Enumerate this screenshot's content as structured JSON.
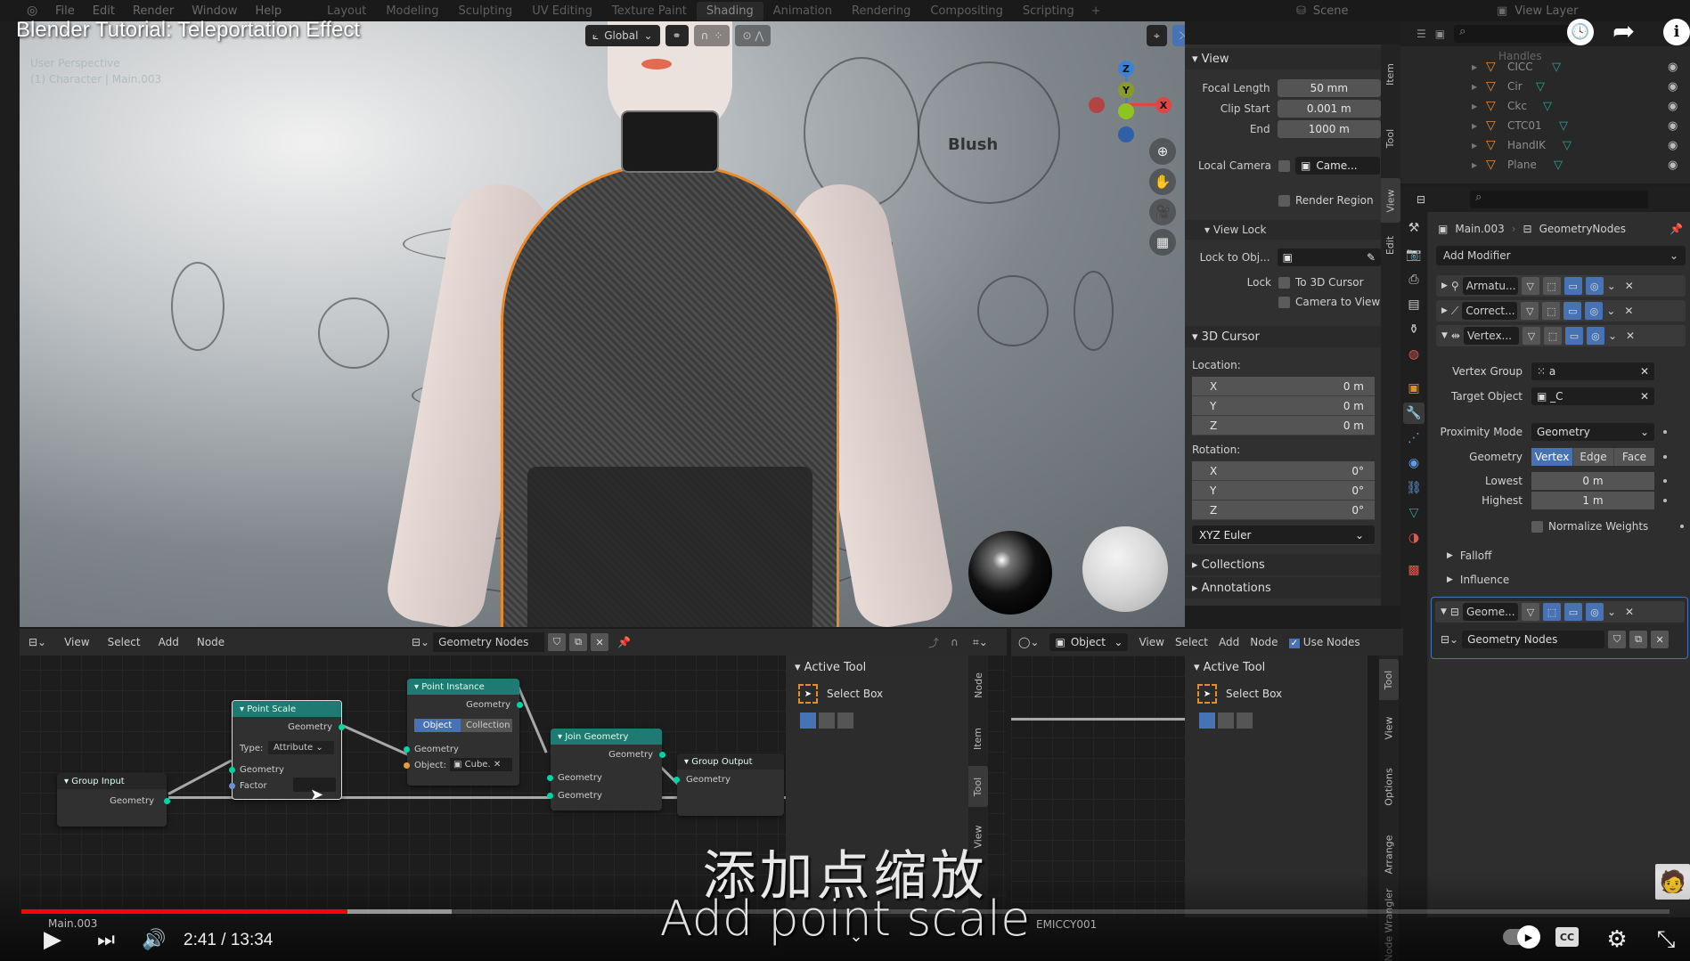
{
  "video": {
    "title": "Blender Tutorial: Teleportation Effect",
    "current_time": "2:41",
    "separator": " / ",
    "duration": "13:34",
    "progress_fraction": 0.198,
    "buffered_fraction": 0.261,
    "subtitle_cn": "添加点缩放",
    "subtitle_en": "Add point scale",
    "watermark": "EMICCY001",
    "chapter_label": "Main.003",
    "icons": {
      "watch_later": "clock-icon",
      "share": "share-arrow-icon",
      "info": "info-icon",
      "play": "play-icon",
      "next": "next-icon",
      "volume": "volume-icon",
      "autoplay": "autoplay-toggle-icon",
      "captions": "cc-icon",
      "settings": "gear-icon",
      "exit_fullscreen": "exit-fullscreen-icon"
    },
    "glyphs": {
      "clock": "🕓",
      "share": "➦",
      "info": "i",
      "play": "▶",
      "next": "⏭",
      "volume": "🔊",
      "autoplay_knob": "▶",
      "cc": "CC",
      "gear": "⚙",
      "exit_fs": "⤡",
      "chevron": "⌄"
    }
  },
  "blender": {
    "menu": [
      "File",
      "Edit",
      "Render",
      "Window",
      "Help"
    ],
    "workspaces": [
      "Layout",
      "Modeling",
      "Sculpting",
      "UV Editing",
      "Texture Paint",
      "Shading",
      "Animation",
      "Rendering",
      "Compositing",
      "Scripting",
      "+"
    ],
    "active_workspace": "Shading",
    "scene": "Scene",
    "view_layer": "View Layer",
    "viewport": {
      "overlay_line1": "User Perspective",
      "overlay_line2": "(1) Character | Main.003",
      "transform_orientation": "Global",
      "annotation_label": "Blush",
      "gizmo": {
        "x": "X",
        "y": "Y",
        "z": "Z"
      }
    },
    "npanel": {
      "tabs": [
        "Item",
        "Tool",
        "View",
        "Edit"
      ],
      "active_tab": "View",
      "view_section": "View",
      "focal_length_label": "Focal Length",
      "focal_length": "50 mm",
      "clip_start_label": "Clip Start",
      "clip_start": "0.001 m",
      "end_label": "End",
      "end": "1000 m",
      "local_camera_label": "Local Camera",
      "local_camera_value": "Came...",
      "render_region_label": "Render Region",
      "view_lock_section": "View Lock",
      "lock_to_obj_label": "Lock to Obj...",
      "lock_label": "Lock",
      "to_3d_cursor": "To 3D Cursor",
      "camera_to_view": "Camera to View",
      "cursor_section": "3D Cursor",
      "location_label": "Location:",
      "location": [
        {
          "axis": "X",
          "value": "0 m"
        },
        {
          "axis": "Y",
          "value": "0 m"
        },
        {
          "axis": "Z",
          "value": "0 m"
        }
      ],
      "rotation_label": "Rotation:",
      "rotation": [
        {
          "axis": "X",
          "value": "0°"
        },
        {
          "axis": "Y",
          "value": "0°"
        },
        {
          "axis": "Z",
          "value": "0°"
        }
      ],
      "rotation_mode": "XYZ Euler",
      "collections": "Collections",
      "annotations": "Annotations"
    },
    "outliner": {
      "partial_top": "Handles",
      "items": [
        "CICC",
        "Cir",
        "Ckc",
        "CTC01",
        "HandIK",
        "Plane"
      ]
    },
    "properties": {
      "object": "Main.003",
      "modifier_context": "GeometryNodes",
      "add_modifier": "Add Modifier",
      "modifiers": [
        {
          "name": "Armatu...",
          "icon": "armature-icon",
          "expanded": false
        },
        {
          "name": "Correct...",
          "icon": "corrective-smooth-icon",
          "expanded": false
        },
        {
          "name": "Vertex...",
          "icon": "vertex-weight-icon",
          "expanded": true
        },
        {
          "name": "Geome...",
          "icon": "geometry-nodes-icon",
          "expanded": true
        }
      ],
      "vertex_group_label": "Vertex Group",
      "vertex_group": "a",
      "target_object_label": "Target Object",
      "target_object": "_C",
      "proximity_mode_label": "Proximity Mode",
      "proximity_mode": "Geometry",
      "geometry_label": "Geometry",
      "geometry_options": [
        "Vertex",
        "Edge",
        "Face"
      ],
      "geometry_active": "Vertex",
      "lowest_label": "Lowest",
      "lowest": "0 m",
      "highest_label": "Highest",
      "highest": "1 m",
      "normalize_weights": "Normalize Weights",
      "falloff": "Falloff",
      "influence": "Influence",
      "node_group": "Geometry Nodes",
      "tab_icons": [
        "tool-icon",
        "render-icon",
        "output-icon",
        "view-layer-icon",
        "scene-icon",
        "world-icon",
        "object-icon",
        "modifier-icon",
        "particles-icon",
        "physics-icon",
        "constraints-icon",
        "data-icon",
        "material-icon",
        "texture-icon"
      ]
    },
    "node_editor": {
      "menu": [
        "View",
        "Select",
        "Add",
        "Node"
      ],
      "tree_name": "Geometry Nodes",
      "nodes": {
        "group_input": {
          "title": "Group Input",
          "out": "Geometry"
        },
        "point_scale": {
          "title": "Point Scale",
          "out": "Geometry",
          "type_label": "Type:",
          "type_value": "Attribute",
          "in1": "Geometry",
          "in2": "Factor"
        },
        "point_instance": {
          "title": "Point Instance",
          "out": "Geometry",
          "btn_object": "Object",
          "btn_collection": "Collection",
          "in1": "Geometry",
          "object_label": "Object:",
          "object_value": "Cube."
        },
        "join_geometry": {
          "title": "Join Geometry",
          "out": "Geometry",
          "in1": "Geometry",
          "in2": "Geometry"
        },
        "group_output": {
          "title": "Group Output",
          "in1": "Geometry"
        }
      },
      "sidebar": {
        "section": "Active Tool",
        "tool": "Select Box",
        "tabs": [
          "Node",
          "Item",
          "Tool",
          "View"
        ]
      }
    },
    "shader_editor": {
      "mode": "Object",
      "menu": [
        "View",
        "Select",
        "Add",
        "Node"
      ],
      "use_nodes": "Use Nodes",
      "sidebar": {
        "section": "Active Tool",
        "tool": "Select Box",
        "tabs": [
          "Tool",
          "View",
          "Options",
          "Arrange",
          "Node Wrangler"
        ]
      }
    }
  }
}
